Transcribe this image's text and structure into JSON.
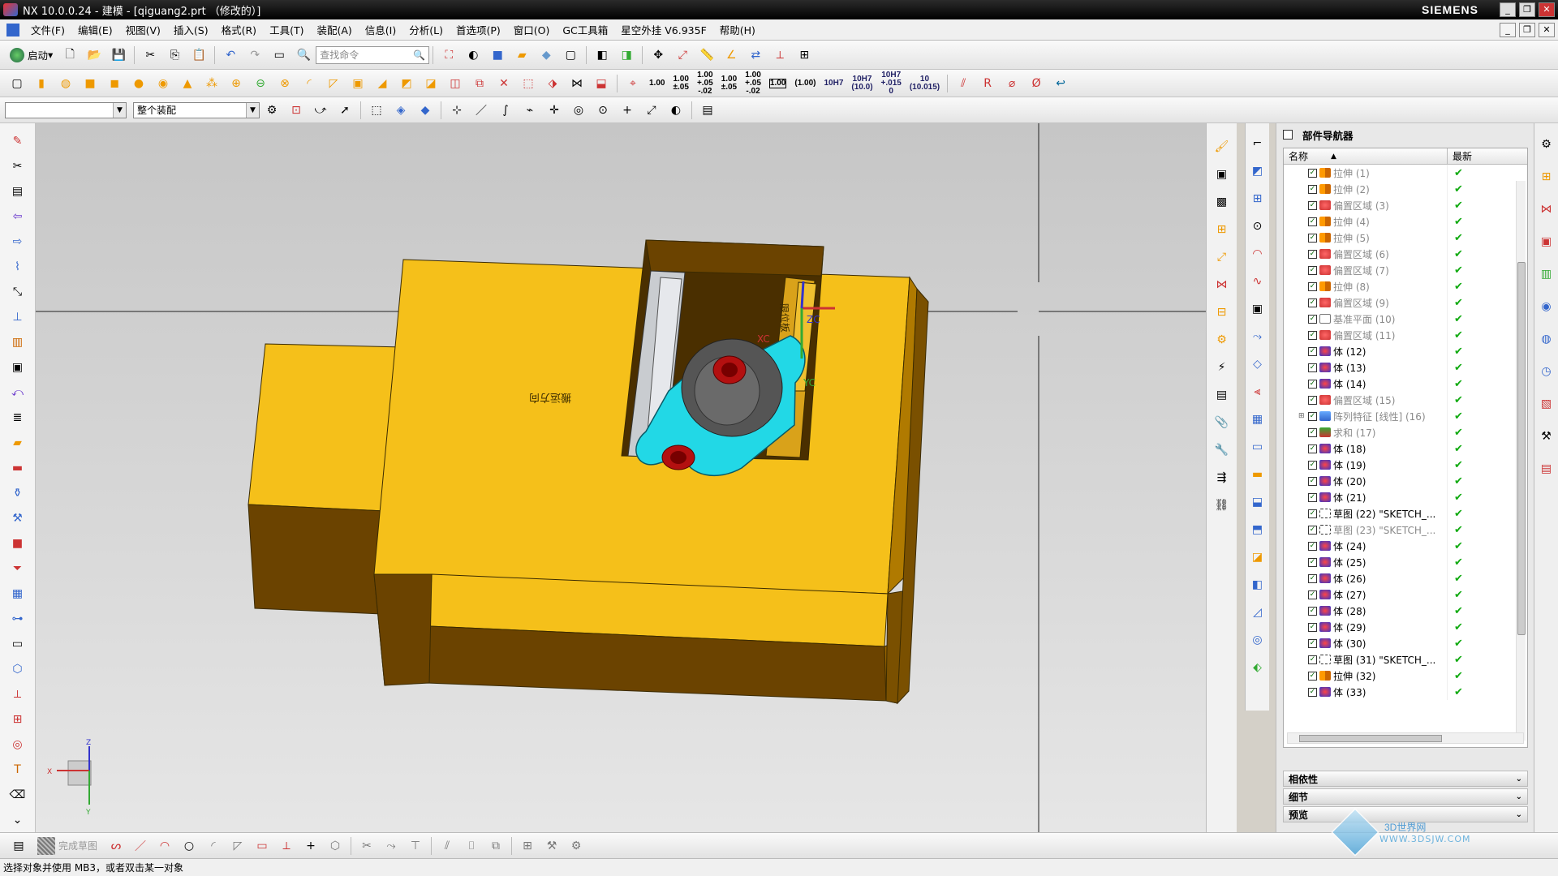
{
  "window": {
    "title": "NX 10.0.0.24 - 建模 - [qiguang2.prt （修改的）]",
    "brand": "SIEMENS"
  },
  "menu": [
    "文件(F)",
    "编辑(E)",
    "视图(V)",
    "插入(S)",
    "格式(R)",
    "工具(T)",
    "装配(A)",
    "信息(I)",
    "分析(L)",
    "首选项(P)",
    "窗口(O)",
    "GC工具箱",
    "星空外挂 V6.935F",
    "帮助(H)"
  ],
  "toolbar": {
    "start_label": "启动",
    "search_placeholder": "查找命令",
    "format_labels": [
      "1.00",
      "1.00\n±.05",
      "1.00\n+.05\n-.02",
      "1.00\n±.05",
      "1.00\n+.05\n-.02",
      "1.00",
      "(1.00)",
      "10H7",
      "10H7\n(10.0)",
      "10H7\n+.015\n0",
      "10\n(10.015)"
    ],
    "filter_select_value": "",
    "assembly_select_value": "整个装配"
  },
  "viewport": {
    "part_text": "搬运方向",
    "label_text": "限位板",
    "csys": {
      "x": "XC",
      "y": "YC",
      "z": "ZC"
    },
    "triad": {
      "x": "X",
      "y": "Y",
      "z": "Z"
    }
  },
  "navigator": {
    "title": "部件导航器",
    "col_name": "名称",
    "col_status": "最新",
    "rows": [
      {
        "label": "拉伸 (1)",
        "icon": "extrude",
        "active": false
      },
      {
        "label": "拉伸 (2)",
        "icon": "extrude",
        "active": false
      },
      {
        "label": "偏置区域 (3)",
        "icon": "offset",
        "active": false
      },
      {
        "label": "拉伸 (4)",
        "icon": "extrude",
        "active": false
      },
      {
        "label": "拉伸 (5)",
        "icon": "extrude",
        "active": false
      },
      {
        "label": "偏置区域 (6)",
        "icon": "offset",
        "active": false
      },
      {
        "label": "偏置区域 (7)",
        "icon": "offset",
        "active": false
      },
      {
        "label": "拉伸 (8)",
        "icon": "extrude",
        "active": false
      },
      {
        "label": "偏置区域 (9)",
        "icon": "offset",
        "active": false
      },
      {
        "label": "基准平面 (10)",
        "icon": "plane",
        "active": false
      },
      {
        "label": "偏置区域 (11)",
        "icon": "offset",
        "active": false
      },
      {
        "label": "体 (12)",
        "icon": "body",
        "active": true
      },
      {
        "label": "体 (13)",
        "icon": "body",
        "active": true
      },
      {
        "label": "体 (14)",
        "icon": "body",
        "active": true
      },
      {
        "label": "偏置区域 (15)",
        "icon": "offset",
        "active": false
      },
      {
        "label": "阵列特征 [线性] (16)",
        "icon": "pattern",
        "active": false
      },
      {
        "label": "求和 (17)",
        "icon": "unite",
        "active": false
      },
      {
        "label": "体 (18)",
        "icon": "body",
        "active": true
      },
      {
        "label": "体 (19)",
        "icon": "body",
        "active": true
      },
      {
        "label": "体 (20)",
        "icon": "body",
        "active": true
      },
      {
        "label": "体 (21)",
        "icon": "body",
        "active": true
      },
      {
        "label": "草图 (22) \"SKETCH_...",
        "icon": "sketch",
        "active": true
      },
      {
        "label": "草图 (23) \"SKETCH_...",
        "icon": "sketch",
        "active": false
      },
      {
        "label": "体 (24)",
        "icon": "body",
        "active": true
      },
      {
        "label": "体 (25)",
        "icon": "body",
        "active": true
      },
      {
        "label": "体 (26)",
        "icon": "body",
        "active": true
      },
      {
        "label": "体 (27)",
        "icon": "body",
        "active": true
      },
      {
        "label": "体 (28)",
        "icon": "body",
        "active": true
      },
      {
        "label": "体 (29)",
        "icon": "body",
        "active": true
      },
      {
        "label": "体 (30)",
        "icon": "body",
        "active": true
      },
      {
        "label": "草图 (31) \"SKETCH_...",
        "icon": "sketch",
        "active": true
      },
      {
        "label": "拉伸 (32)",
        "icon": "extrude",
        "active": true
      },
      {
        "label": "体 (33)",
        "icon": "body",
        "active": true
      }
    ],
    "sections": [
      "相依性",
      "细节",
      "预览"
    ]
  },
  "bottom": {
    "finish_sketch": "完成草图"
  },
  "status": "选择对象并使用 MB3，或者双击某一对象",
  "watermark": {
    "text": "3D世界网",
    "url": "WWW.3DSJW.COM"
  },
  "colors": {
    "part_top": "#f5c01a",
    "part_side": "#6b4300",
    "part_dark": "#b07a00",
    "cyan_part": "#22d8e6",
    "accent_red": "#b31010"
  }
}
